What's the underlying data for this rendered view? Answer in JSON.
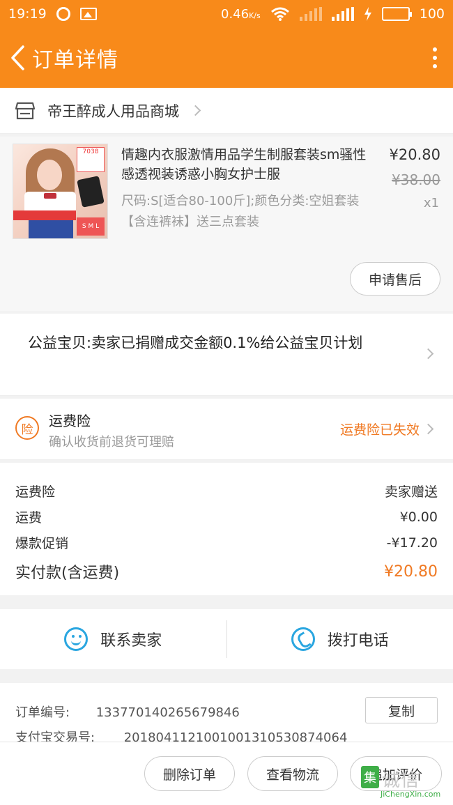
{
  "statusbar": {
    "time": "19:19",
    "speed": "0.46",
    "speed_unit": "K/s",
    "battery": "100"
  },
  "header": {
    "title": "订单详情"
  },
  "shop": {
    "name": "帝王醉成人用品商城"
  },
  "product": {
    "title": "情趣内衣服激情用品学生制服套装sm骚性感透视装诱惑小胸女护士服",
    "sku": "尺码:S[适合80-100斤];颜色分类:空姐套装【含连裤袜】送三点套装",
    "price": "¥20.80",
    "original_price": "¥38.00",
    "quantity": "x1",
    "image_tag": "7038",
    "after_sale_label": "申请售后"
  },
  "charity": {
    "text": "公益宝贝:卖家已捐赠成交金额0.1%给公益宝贝计划"
  },
  "insurance": {
    "icon_text": "险",
    "title": "运费险",
    "subtitle": "确认收货前退货可理赔",
    "status": "运费险已失效"
  },
  "fees": {
    "rows": [
      {
        "label": "运费险",
        "value": "卖家赠送"
      },
      {
        "label": "运费",
        "value": "¥0.00"
      },
      {
        "label": "爆款促销",
        "value": "-¥17.20"
      }
    ],
    "total_label": "实付款(含运费)",
    "total_value": "¥20.80"
  },
  "contact": {
    "seller_label": "联系卖家",
    "phone_label": "拨打电话"
  },
  "order_info": {
    "order_no_label": "订单编号:",
    "order_no": "133770140265679846",
    "alipay_label": "支付宝交易号:",
    "alipay_no": "2018041121001001310530874064",
    "copy_label": "复制"
  },
  "bottom_actions": {
    "delete": "删除订单",
    "logistics": "查看物流",
    "review": "追加评价"
  },
  "watermark": {
    "mark": "集",
    "cn": "诚信",
    "en": "JiChengXin.com"
  },
  "colors": {
    "brand": "#f88a1a",
    "accent": "#f07a24",
    "link_blue": "#2aa6e0"
  }
}
